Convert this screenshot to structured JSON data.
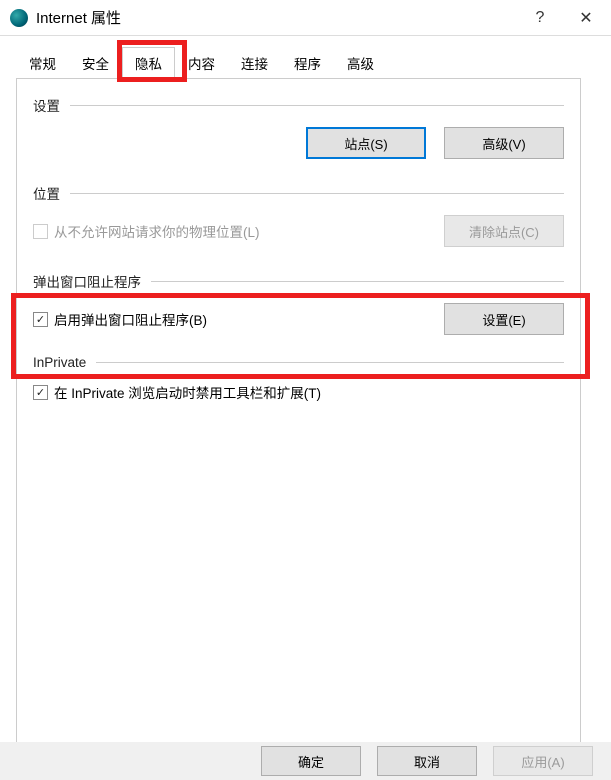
{
  "titlebar": {
    "title": "Internet 属性",
    "help": "?",
    "close": "✕"
  },
  "tabs": {
    "general": "常规",
    "security": "安全",
    "privacy": "隐私",
    "content": "内容",
    "connections": "连接",
    "programs": "程序",
    "advanced": "高级"
  },
  "settings": {
    "title": "设置",
    "sites_btn": "站点(S)",
    "advanced_btn": "高级(V)"
  },
  "location": {
    "title": "位置",
    "checkbox_label": "从不允许网站请求你的物理位置(L)",
    "clear_btn": "清除站点(C)"
  },
  "popup": {
    "title": "弹出窗口阻止程序",
    "checkbox_label": "启用弹出窗口阻止程序(B)",
    "settings_btn": "设置(E)"
  },
  "inprivate": {
    "title": "InPrivate",
    "checkbox_label": "在 InPrivate 浏览启动时禁用工具栏和扩展(T)"
  },
  "footer": {
    "ok": "确定",
    "cancel": "取消",
    "apply": "应用(A)"
  }
}
